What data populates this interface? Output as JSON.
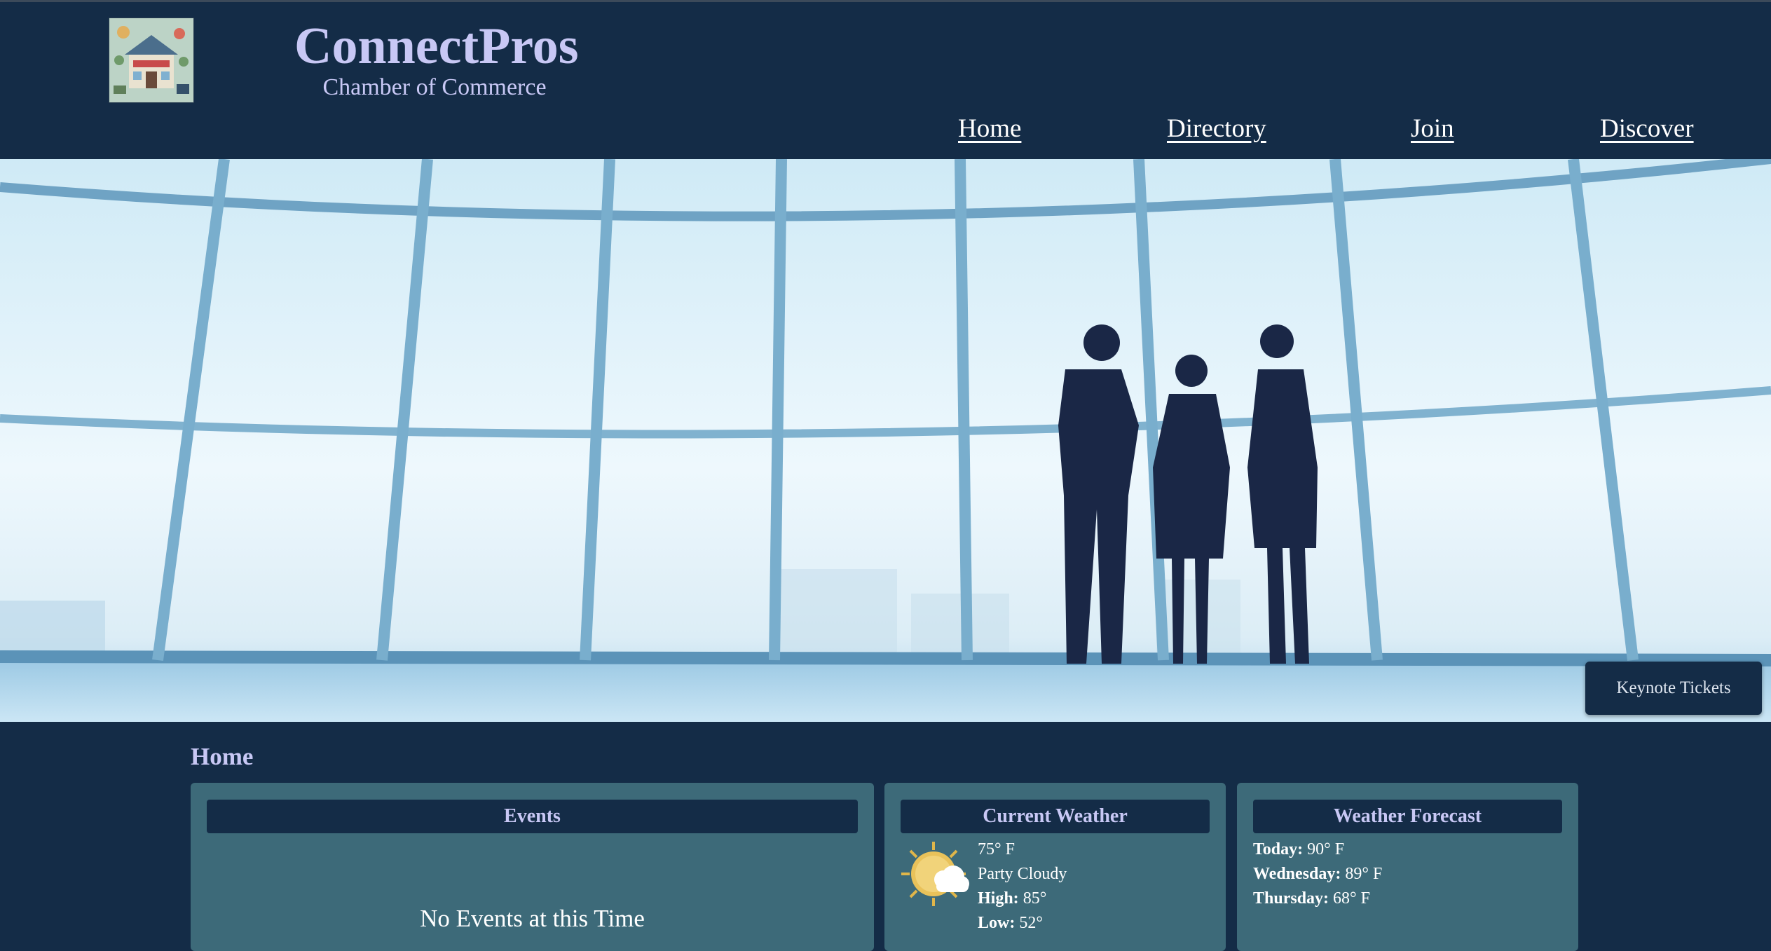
{
  "brand": {
    "title": "ConnectPros",
    "subtitle": "Chamber of Commerce"
  },
  "nav": {
    "items": [
      "Home",
      "Directory",
      "Join",
      "Discover"
    ]
  },
  "hero": {
    "cta_label": "Keynote Tickets"
  },
  "main": {
    "heading": "Home"
  },
  "events": {
    "title": "Events",
    "empty_message": "No Events at this Time"
  },
  "weather": {
    "title": "Current Weather",
    "icon": "partly-cloudy-icon",
    "temp": "75° F",
    "condition": "Party Cloudy",
    "high_label": "High:",
    "high": "85°",
    "low_label": "Low:",
    "low": "52°"
  },
  "forecast": {
    "title": "Weather Forecast",
    "days": [
      {
        "label": "Today:",
        "temp": "90° F"
      },
      {
        "label": "Wednesday:",
        "temp": "89° F"
      },
      {
        "label": "Thursday:",
        "temp": "68° F"
      }
    ]
  },
  "colors": {
    "page_bg": "#142c47",
    "card_bg": "#3d6a79",
    "accent_text": "#c8c8f5"
  }
}
